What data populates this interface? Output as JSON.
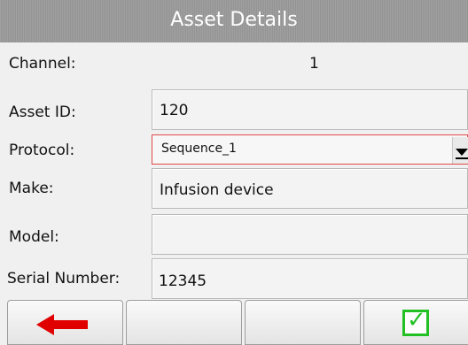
{
  "title": "Asset Details",
  "fields": {
    "channel": {
      "label": "Channel:",
      "value": "1"
    },
    "asset_id": {
      "label": "Asset ID:",
      "value": "120"
    },
    "protocol": {
      "label": "Protocol:",
      "value": "Sequence_1"
    },
    "make": {
      "label": "Make:",
      "value": "Infusion device"
    },
    "model": {
      "label": "Model:",
      "value": ""
    },
    "serial": {
      "label": "Serial Number:",
      "value": "12345"
    }
  },
  "bottom_buttons": [
    {
      "icon": "arrow-left-icon"
    },
    {
      "icon": ""
    },
    {
      "icon": ""
    },
    {
      "icon": "check-icon"
    }
  ],
  "colors": {
    "titlebar": "#9a9a9a",
    "back_arrow": "#e00000",
    "check": "#22c022",
    "select_border": "#e04848"
  }
}
